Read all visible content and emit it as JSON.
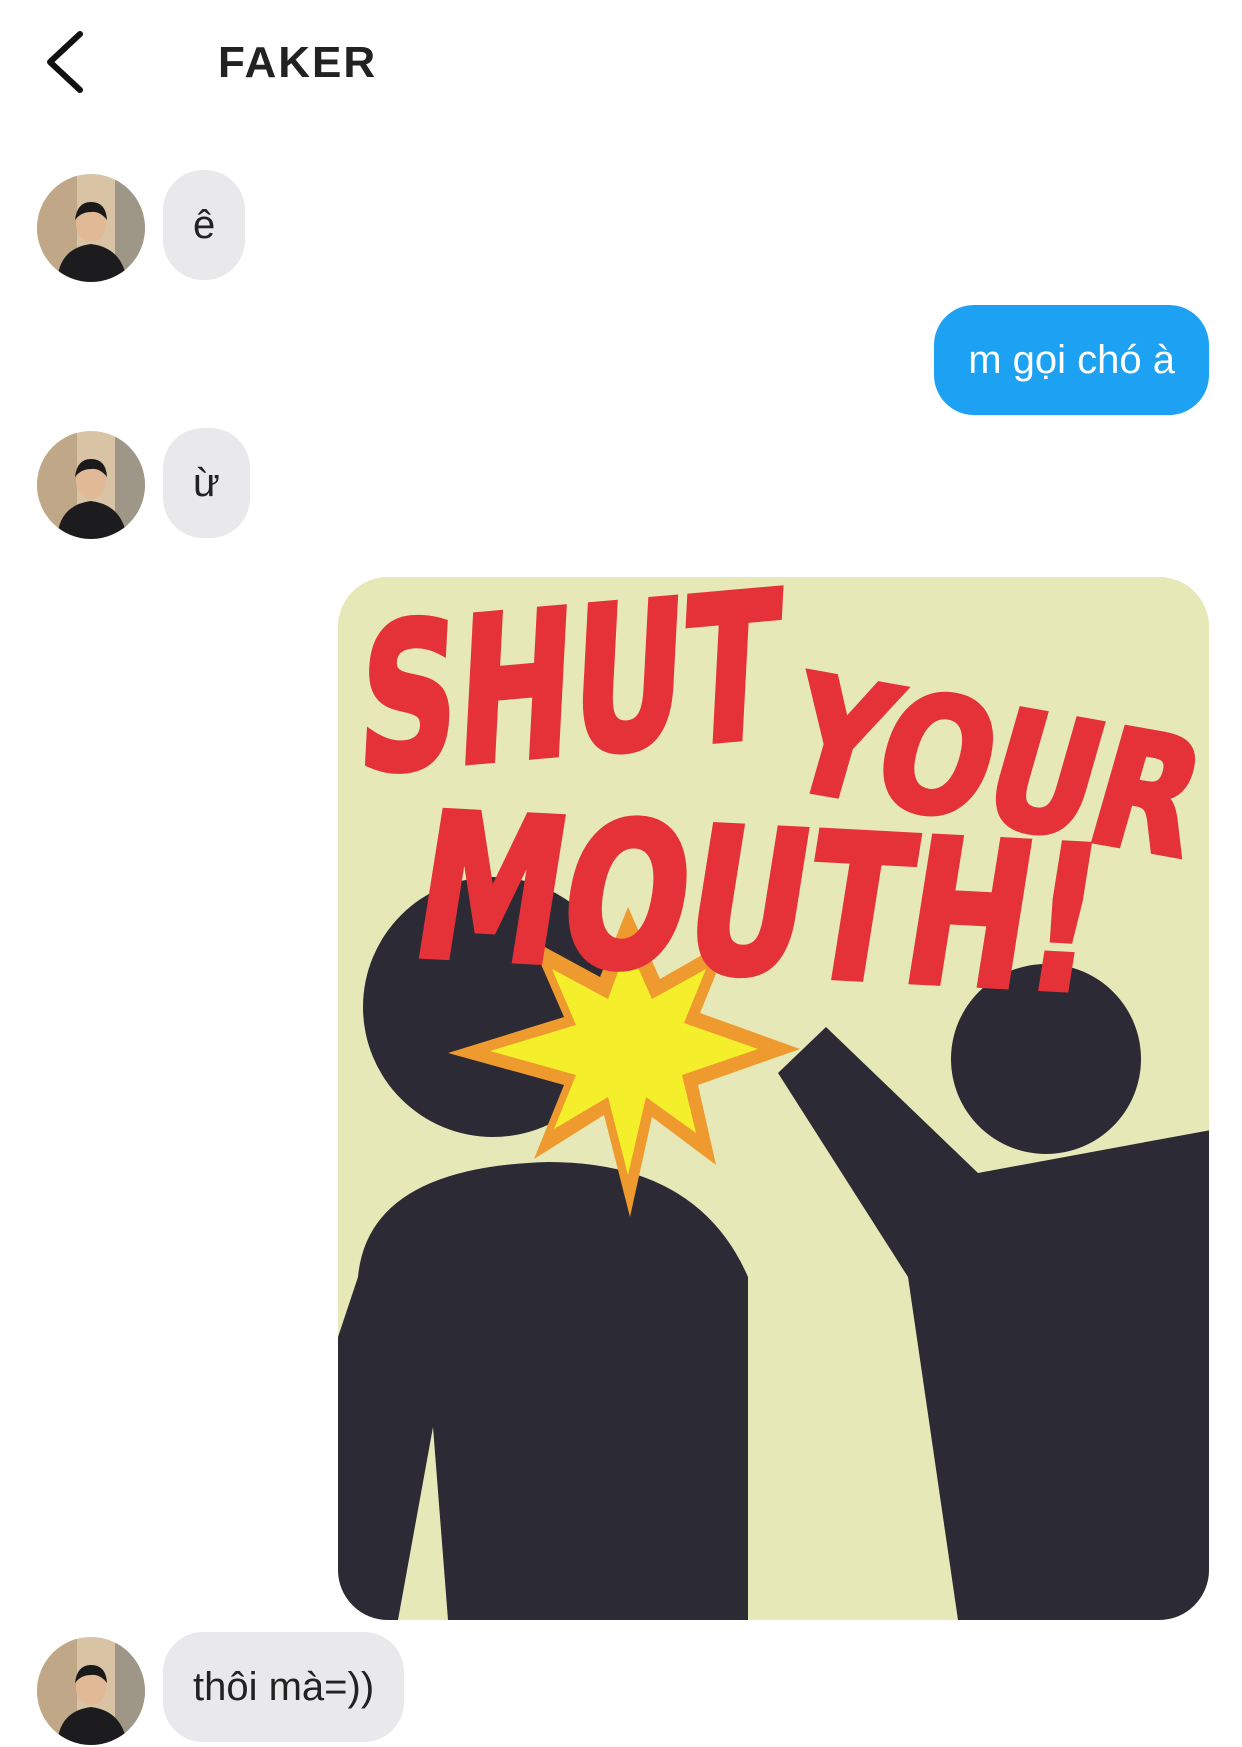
{
  "header": {
    "title": "FAKER",
    "back_icon": "chevron-left-icon"
  },
  "messages": [
    {
      "side": "incoming",
      "text": "ê"
    },
    {
      "side": "outgoing",
      "text": "m gọi chó à"
    },
    {
      "side": "incoming",
      "text": "ừ"
    },
    {
      "side": "outgoing",
      "type": "image",
      "image_text": "SHUT YOUR MOUTH!"
    },
    {
      "side": "incoming",
      "text": "thôi mà=))"
    }
  ],
  "colors": {
    "outgoing_bubble": "#1da1f2",
    "incoming_bubble": "#e9e9eb",
    "poster_background": "#e7e8b8",
    "poster_lettering": "#e43238",
    "poster_figure": "#2b2a35",
    "poster_burst_outer": "#ee9a2e",
    "poster_burst_inner": "#f4ef2a"
  }
}
